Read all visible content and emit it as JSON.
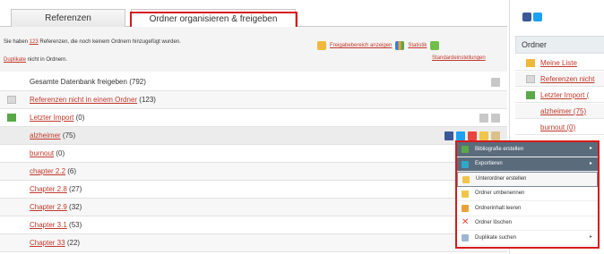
{
  "tabs": [
    "Referenzen",
    "Ordner organisieren & freigeben"
  ],
  "info": {
    "line1_pre": "Sie haben ",
    "line1_link": "123",
    "line1_post": " Referenzen, die noch keinem Ordnern hinzugefügt wurden.",
    "line2_link": "Duplikate",
    "line2_post": " nicht in Ordnern.",
    "release_link": "Freigabebereich anzeigen",
    "stats_link": "Statistik",
    "defaults_link": "Standardeinstellungen"
  },
  "rows": [
    {
      "name": "Gesamte Datenbank freigeben",
      "count": "(792)"
    },
    {
      "name": "Referenzen nicht in einem Ordner",
      "count": "(123)"
    },
    {
      "name": "Letzter Import",
      "count": "(0)"
    },
    {
      "name": "alzheimer",
      "count": "(75)"
    },
    {
      "name": "burnout",
      "count": "(0)"
    },
    {
      "name": "chapter 2.2",
      "count": "(6)"
    },
    {
      "name": "Chapter 2.8",
      "count": "(27)"
    },
    {
      "name": "Chapter 2.9",
      "count": "(32)"
    },
    {
      "name": "Chapter 3.1",
      "count": "(53)"
    },
    {
      "name": "Chapter 33",
      "count": "(22)"
    }
  ],
  "sidebar": {
    "title": "Ordner",
    "items": [
      "Meine Liste",
      "Referenzen nicht",
      "Letzter Import (",
      "alzheimer (75)",
      "burnout (0)"
    ]
  },
  "context_menu": [
    "Bibliografie erstellen",
    "Exportieren",
    "Unterordner erstellen",
    "Ordner umbenennen",
    "Ordnerinhalt leeren",
    "Ordner löschen",
    "Duplikate suchen"
  ],
  "colors": {
    "highlight": "#d61a1a",
    "link": "#c0392b"
  }
}
